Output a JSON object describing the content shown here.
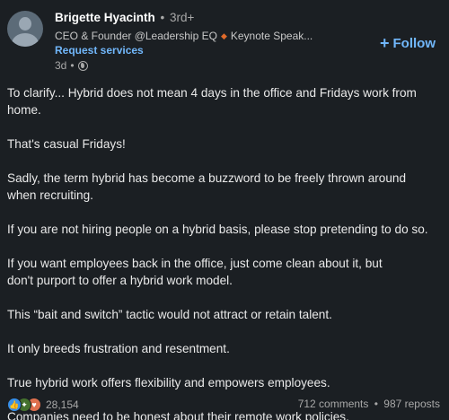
{
  "author": {
    "name": "Brigette Hyacinth",
    "separator": "•",
    "degree": "3rd+",
    "headline_part1": "CEO & Founder @Leadership EQ",
    "headline_diamond": "◆",
    "headline_part2": "Keynote Speak...",
    "request_services": "Request services",
    "time": "3d",
    "time_separator": "•",
    "visibility_icon": "globe-icon"
  },
  "follow": {
    "plus": "+",
    "label": "Follow"
  },
  "post": {
    "paragraphs": [
      "To clarify... Hybrid does not mean 4 days in the office and Fridays work from home.",
      "That's casual Fridays!",
      "Sadly, the term hybrid has become a buzzword to be freely thrown around when recruiting.",
      "If you are not hiring people on a hybrid basis, please stop pretending to do so.",
      "If you want employees back in the office, just come clean about it, but don't purport to offer a hybrid work model.",
      "This “bait and switch” tactic would not attract or retain talent.",
      "It only breeds frustration and resentment.",
      "True hybrid work offers flexibility and empowers employees.",
      "Companies need to be honest about their remote work policies."
    ]
  },
  "social": {
    "reaction_icons": [
      "like-icon",
      "celebrate-icon",
      "love-icon"
    ],
    "reaction_count": "28,154",
    "comments": "712 comments",
    "separator": "•",
    "reposts": "987 reposts"
  },
  "colors": {
    "background": "#1b1f23",
    "link_blue": "#71b7fb",
    "like_blue": "#378fe9",
    "celebrate_green": "#44712e",
    "love_orange": "#df704d",
    "diamond_orange": "#e06a2a"
  }
}
